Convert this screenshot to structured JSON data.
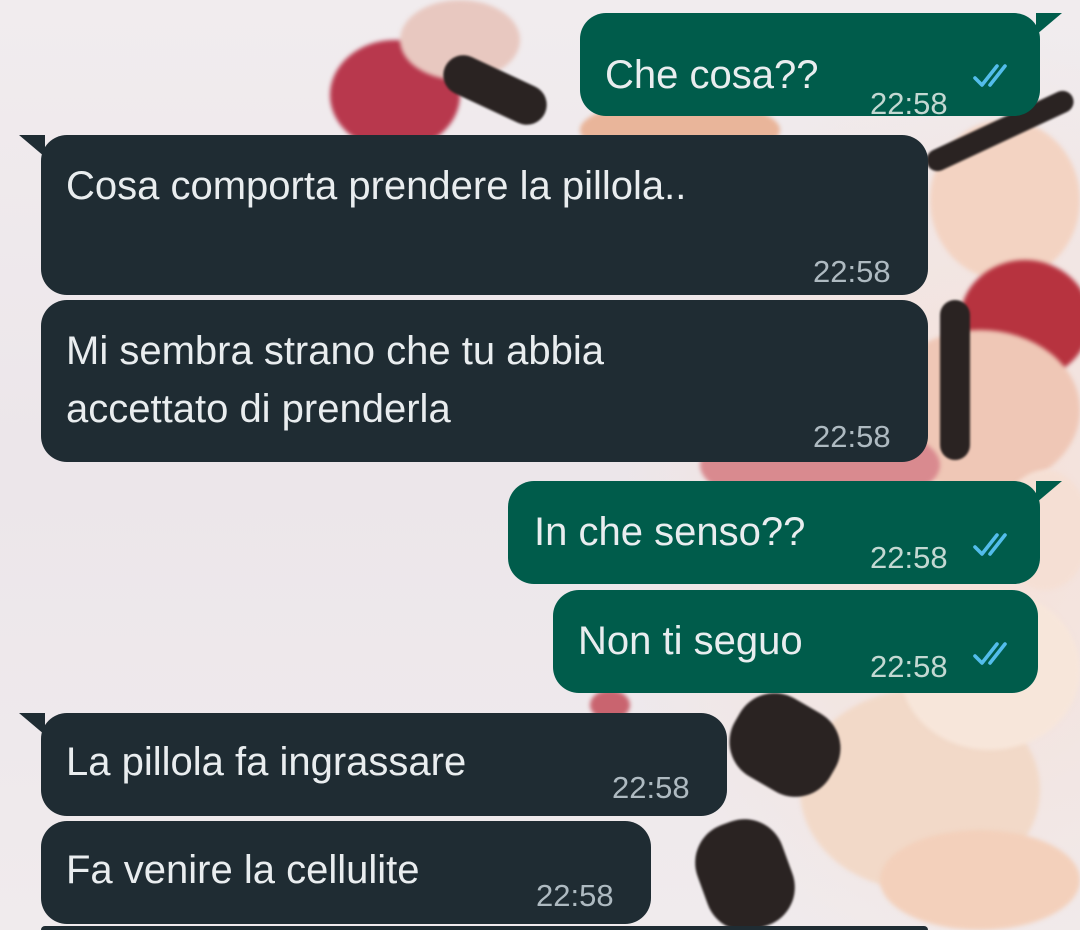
{
  "conversation": {
    "messages": [
      {
        "direction": "outgoing",
        "text": "Che cosa??",
        "time": "22:58",
        "status": "read-double-tick"
      },
      {
        "direction": "incoming",
        "text": "Cosa comporta prendere la pillola..",
        "time": "22:58"
      },
      {
        "direction": "incoming",
        "line1": "Mi sembra strano che tu abbia",
        "line2": "accettato di prenderla",
        "time": "22:58"
      },
      {
        "direction": "outgoing",
        "text": "In che senso??",
        "time": "22:58",
        "status": "read-double-tick"
      },
      {
        "direction": "outgoing",
        "text": "Non ti seguo",
        "time": "22:58",
        "status": "read-double-tick"
      },
      {
        "direction": "incoming",
        "text": "La pillola fa ingrassare",
        "time": "22:58"
      },
      {
        "direction": "incoming",
        "text": "Fa venire la cellulite",
        "time": "22:58"
      }
    ]
  },
  "colors": {
    "incoming_bubble": "#1f2c33",
    "outgoing_bubble": "#005c4b",
    "read_tick": "#53bdeb",
    "message_text": "#e9edef",
    "time_text": "#aebac1"
  },
  "icons": {
    "read_receipt": "double-check-icon"
  }
}
